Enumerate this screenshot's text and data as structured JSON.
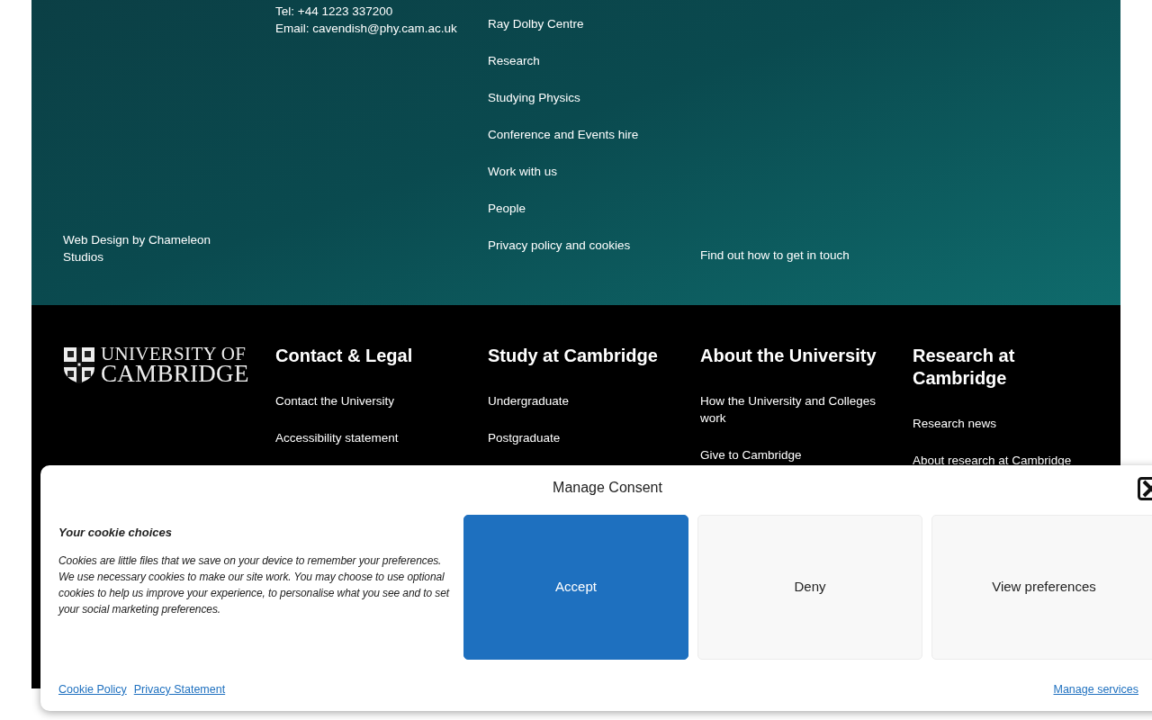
{
  "footer_top": {
    "credit": "Web Design by Chameleon Studios",
    "contact": [
      "Tel: +44 1223 337200",
      "Email: cavendish@phy.cam.ac.uk"
    ],
    "links": [
      "Ray Dolby Centre",
      "Research",
      "Studying Physics",
      "Conference and Events hire",
      "Work with us",
      "People",
      "Privacy policy and cookies"
    ],
    "get_in_touch": "Find out how to get in touch"
  },
  "footer_bottom": {
    "logo": {
      "line1": "UNIVERSITY OF",
      "line2": "CAMBRIDGE"
    },
    "columns": [
      {
        "heading": "Contact & Legal",
        "links": [
          "Contact the University",
          "Accessibility statement"
        ]
      },
      {
        "heading": "Study at Cambridge",
        "links": [
          "Undergraduate",
          "Postgraduate"
        ]
      },
      {
        "heading": "About the University",
        "links": [
          "How the University and Colleges work",
          "Give to Cambridge"
        ]
      },
      {
        "heading": "Research at Cambridge",
        "links": [
          "Research news",
          "About research at Cambridge"
        ]
      }
    ]
  },
  "cookie_banner": {
    "title": "Manage Consent",
    "heading": "Your cookie choices",
    "text": "Cookies are little files that we save on your device to remember your preferences. We use necessary cookies to make our site work. You may choose to use optional cookies to help us improve your experience, to personalise what you see and to set your social marketing preferences.",
    "buttons": [
      {
        "label": "Accept",
        "kind": "primary"
      },
      {
        "label": "Deny",
        "kind": "secondary"
      },
      {
        "label": "View preferences",
        "kind": "secondary"
      }
    ],
    "links": [
      "Cookie Policy",
      "Privacy Statement"
    ],
    "manage_link": "Manage services"
  }
}
